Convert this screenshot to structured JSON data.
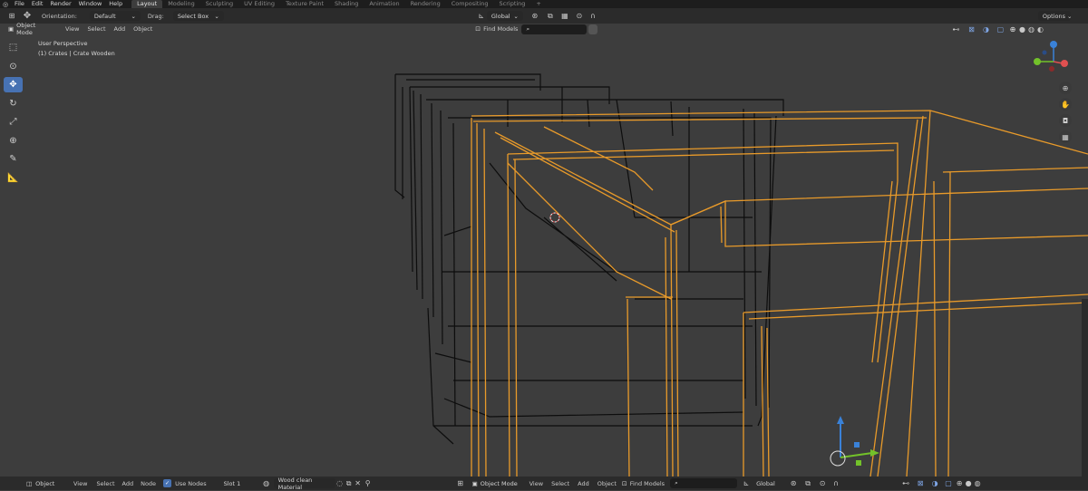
{
  "topbar": {
    "menu": [
      "File",
      "Edit",
      "Render",
      "Window",
      "Help"
    ],
    "workspaces": [
      "Layout",
      "Modeling",
      "Sculpting",
      "UV Editing",
      "Texture Paint",
      "Shading",
      "Animation",
      "Rendering",
      "Compositing",
      "Scripting"
    ],
    "add_workspace": "+"
  },
  "header": {
    "orientation_label": "Orientation:",
    "orientation_value": "Default",
    "drag_label": "Drag:",
    "drag_value": "Select Box",
    "transform_orientation": "Global",
    "options_label": "Options"
  },
  "viewport_header": {
    "mode": "Object Mode",
    "menus": [
      "View",
      "Select",
      "Add",
      "Object"
    ],
    "find_models": "Find Models"
  },
  "viewport": {
    "perspective": "User Perspective",
    "selection": "(1) Crates | Crate Wooden"
  },
  "bottombar": {
    "editor_type": "Object",
    "menus": [
      "View",
      "Select",
      "Add",
      "Node"
    ],
    "use_nodes": "Use Nodes",
    "slot": "Slot 1",
    "material": "Wood clean Material",
    "mode": "Object Mode",
    "menus2": [
      "View",
      "Select",
      "Add",
      "Object"
    ],
    "find_models": "Find Models",
    "orientation": "Global"
  },
  "colors": {
    "accent": "#4772b3",
    "selected_outline": "#e89a2a",
    "wire": "#0d0d0d",
    "background": "#3d3d3d"
  }
}
